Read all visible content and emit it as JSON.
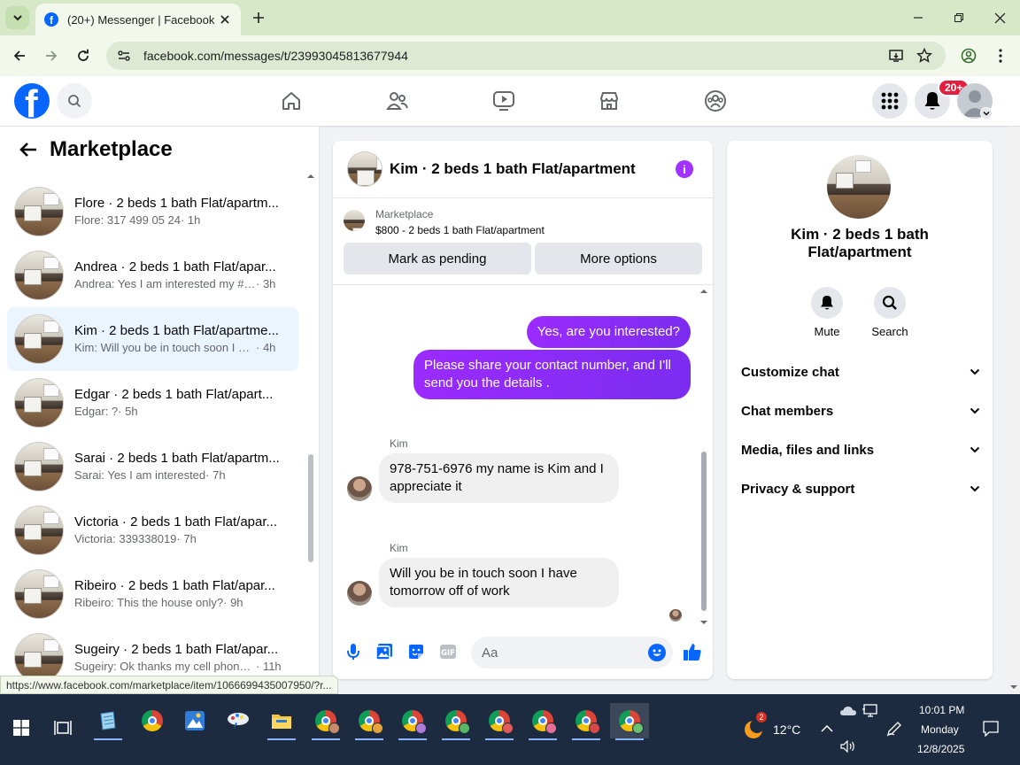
{
  "browser": {
    "tab_title": "(20+) Messenger | Facebook",
    "url": "facebook.com/messages/t/23993045813677944",
    "status_url": "https://www.facebook.com/marketplace/item/1066699435007950/?r..."
  },
  "header": {
    "notification_badge": "20+"
  },
  "sidebar": {
    "title": "Marketplace",
    "conversations": [
      {
        "name": "Flore · 2 beds 1 bath Flat/apartm...",
        "snippet": "Flore: 317 499 05 24",
        "time": "· 1h"
      },
      {
        "name": "Andrea · 2 beds 1 bath Flat/apar...",
        "snippet": "Andrea: Yes I am interested my # is:...",
        "time": "· 3h"
      },
      {
        "name": "Kim · 2 beds 1 bath Flat/apartme...",
        "snippet": "Kim: Will you be in touch soon I ha...",
        "time": "· 4h"
      },
      {
        "name": "Edgar · 2 beds 1 bath Flat/apart...",
        "snippet": "Edgar: ?",
        "time": "· 5h"
      },
      {
        "name": "Sarai · 2 beds 1 bath Flat/apartm...",
        "snippet": "Sarai: Yes I am interested",
        "time": "· 7h"
      },
      {
        "name": "Victoria · 2 beds 1 bath Flat/apar...",
        "snippet": "Victoria: 339338019",
        "time": "· 7h"
      },
      {
        "name": "Ribeiro · 2 beds 1 bath Flat/apar...",
        "snippet": "Ribeiro: This the house only?",
        "time": "· 9h"
      },
      {
        "name": "Sugeiry · 2 beds 1 bath Flat/apar...",
        "snippet": "Sugeiry: Ok thanks my cell phone ...",
        "time": "· 11h"
      }
    ]
  },
  "chat": {
    "title": "Kim · 2 beds 1 bath Flat/apartment",
    "listing_label": "Marketplace",
    "listing_title": "$800 - 2 beds 1 bath Flat/apartment",
    "mark_pending": "Mark as pending",
    "more_options": "More options",
    "messages": {
      "out1": "Yes, are you interested?",
      "out2": "Please share your contact number, and I'll send you the details .",
      "in1_sender": "Kim",
      "in1": "978-751-6976 my name is Kim and I appreciate it",
      "in2_sender": "Kim",
      "in2": "Will you be in touch soon I have tomorrow off of work"
    },
    "composer_placeholder": "Aa"
  },
  "info_panel": {
    "name": "Kim · 2 beds 1 bath Flat/apartment",
    "mute": "Mute",
    "search": "Search",
    "sections": [
      "Customize chat",
      "Chat members",
      "Media, files and links",
      "Privacy & support"
    ]
  },
  "taskbar": {
    "weather_temp": "12°C",
    "weather_badge": "2",
    "time": "10:01 PM",
    "day": "Monday",
    "date": "12/8/2025"
  }
}
